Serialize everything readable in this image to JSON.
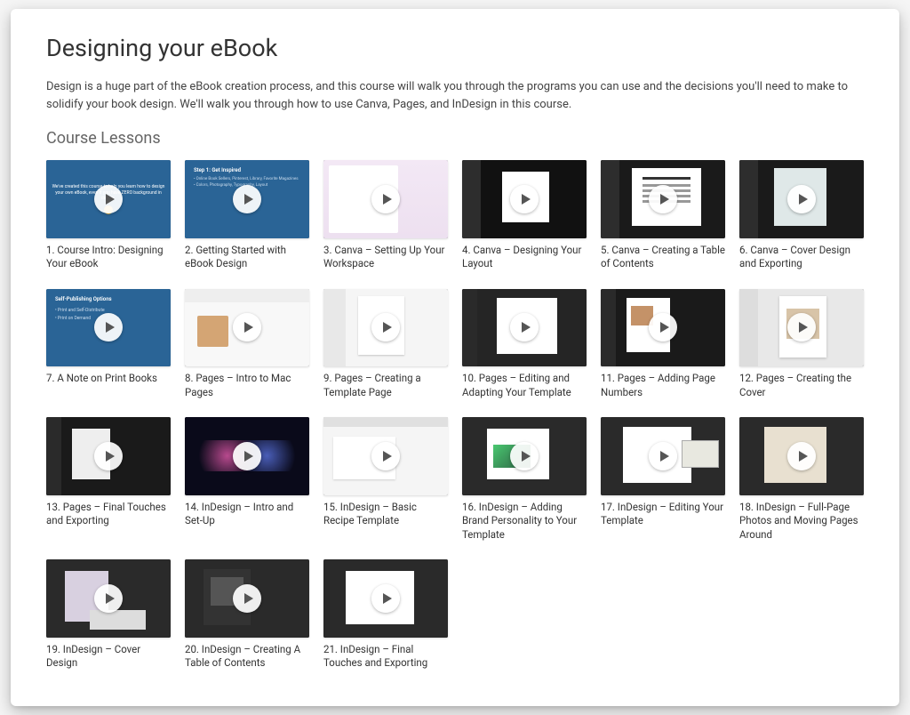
{
  "page": {
    "title": "Designing your eBook",
    "description": "Design is a huge part of the eBook creation process, and this course will walk you through the programs you can use and the decisions you'll need to make to solidify your book design. We'll walk you through how to use Canva, Pages, and InDesign in this course.",
    "section_title": "Course Lessons"
  },
  "lessons": [
    {
      "title": "1. Course Intro: Designing Your eBook"
    },
    {
      "title": "2. Getting Started with eBook Design"
    },
    {
      "title": "3. Canva – Setting Up Your Workspace"
    },
    {
      "title": "4. Canva – Designing Your Layout"
    },
    {
      "title": "5. Canva – Creating a Table of Contents"
    },
    {
      "title": "6. Canva – Cover Design and Exporting"
    },
    {
      "title": "7. A Note on Print Books"
    },
    {
      "title": "8. Pages – Intro to Mac Pages"
    },
    {
      "title": "9. Pages – Creating a Template Page"
    },
    {
      "title": "10. Pages – Editing and Adapting Your Template"
    },
    {
      "title": "11. Pages – Adding Page Numbers"
    },
    {
      "title": "12. Pages – Creating the Cover"
    },
    {
      "title": "13. Pages – Final Touches and Exporting"
    },
    {
      "title": "14. InDesign – Intro and Set-Up"
    },
    {
      "title": "15. InDesign – Basic Recipe Template"
    },
    {
      "title": "16. InDesign – Adding Brand Personality to Your Template"
    },
    {
      "title": "17. InDesign – Editing Your Template"
    },
    {
      "title": "18. InDesign – Full-Page Photos and Moving Pages Around"
    },
    {
      "title": "19. InDesign – Cover Design"
    },
    {
      "title": "20. InDesign – Creating A Table of Contents"
    },
    {
      "title": "21. InDesign – Final Touches and Exporting"
    }
  ],
  "slide1": {
    "text": "We've created this course to help you learn how to design your own eBook, even if you have ZERO background in design."
  },
  "slide2": {
    "header": "Step 1: Get Inspired",
    "l1": "• Online Book Sellers, Pinterest, Library, Favorite Magazines",
    "l2": "• Colors, Photography, Typography, Layout"
  },
  "slide7": {
    "header": "Self-Publishing Options",
    "l1": "• Print and Self-Distribute",
    "l2": "• Print on Demand"
  }
}
